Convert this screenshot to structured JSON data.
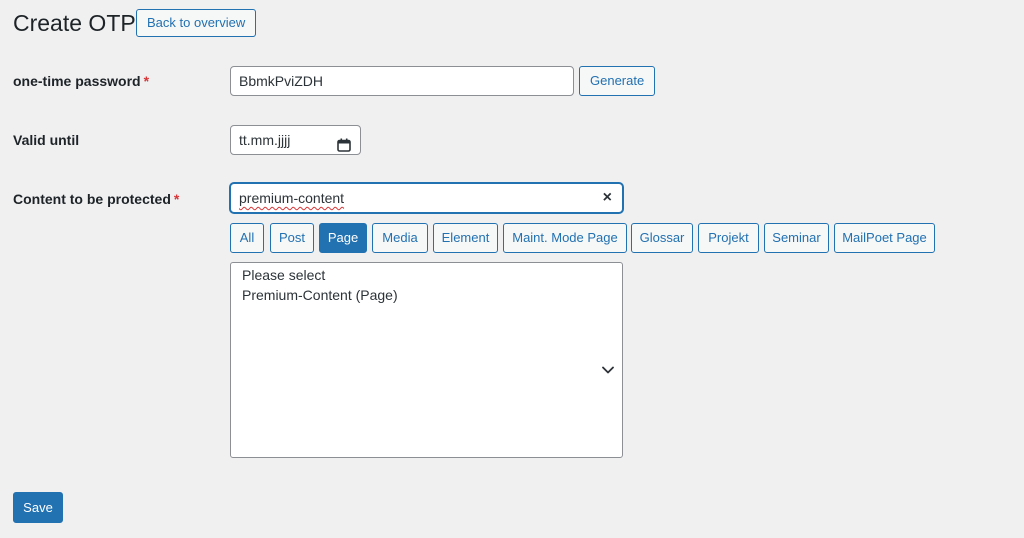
{
  "header": {
    "title": "Create OTP",
    "back_label": "Back to overview"
  },
  "form": {
    "password": {
      "label": "one-time password",
      "required_mark": "*",
      "value": "BbmkPviZDH",
      "generate_label": "Generate"
    },
    "valid_until": {
      "label": "Valid until",
      "placeholder": "tt.mm.jjjj",
      "icon": "calendar-icon"
    },
    "content": {
      "label": "Content to be protected",
      "required_mark": "*",
      "search_value": "premium-content",
      "clear_icon": "×",
      "filters": [
        {
          "label": "All",
          "active": false
        },
        {
          "label": "Post",
          "active": false
        },
        {
          "label": "Page",
          "active": true
        },
        {
          "label": "Media",
          "active": false
        },
        {
          "label": "Element",
          "active": false
        },
        {
          "label": "Maint. Mode Page",
          "active": false
        },
        {
          "label": "Glossar",
          "active": false
        },
        {
          "label": "Projekt",
          "active": false
        },
        {
          "label": "Seminar",
          "active": false
        },
        {
          "label": "MailPoet Page",
          "active": false
        }
      ],
      "options": [
        "Please select",
        "Premium-Content (Page)"
      ]
    }
  },
  "footer": {
    "save_label": "Save"
  },
  "colors": {
    "accent": "#2271b1",
    "required": "#d63638",
    "background": "#f0f0f1"
  }
}
